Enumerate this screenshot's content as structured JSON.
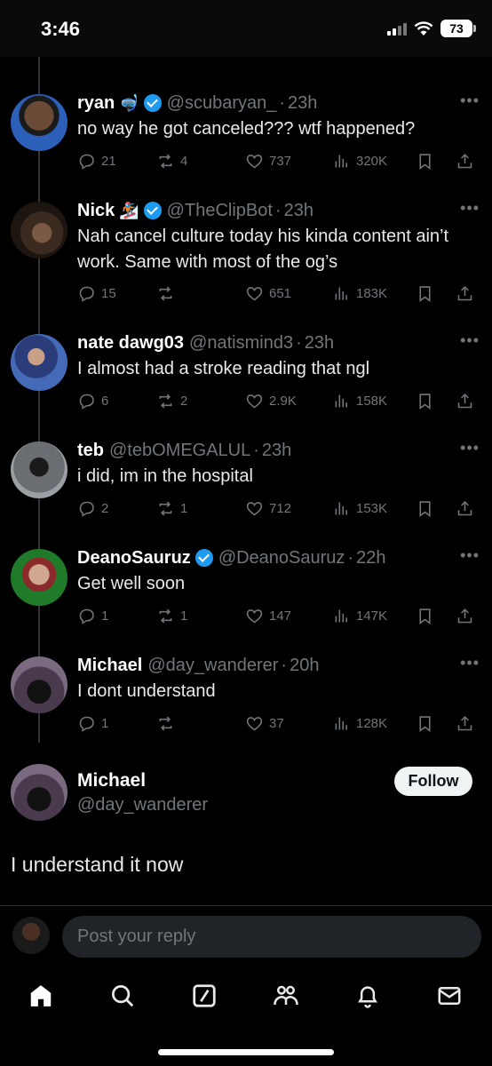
{
  "status": {
    "time": "3:46",
    "battery": "73"
  },
  "tweets": [
    {
      "name": "ryan",
      "emoji": "🤿",
      "verified": true,
      "handle": "@scubaryan_",
      "time": "23h",
      "text": "no way he got canceled??? wtf happened?",
      "replies": "21",
      "reposts": "4",
      "likes": "737",
      "views": "320K"
    },
    {
      "name": "Nick",
      "emoji": "🏂",
      "verified": true,
      "handle": "@TheClipBot",
      "time": "23h",
      "text": "Nah cancel culture today his kinda content ain’t work. Same with most of the og’s",
      "replies": "15",
      "reposts": "",
      "likes": "651",
      "views": "183K"
    },
    {
      "name": "nate dawg03",
      "emoji": "",
      "verified": false,
      "handle": "@natismind3",
      "time": "23h",
      "text": "I almost had a stroke reading that ngl",
      "replies": "6",
      "reposts": "2",
      "likes": "2.9K",
      "views": "158K"
    },
    {
      "name": "teb",
      "emoji": "",
      "verified": false,
      "handle": "@tebOMEGALUL",
      "time": "23h",
      "text": "i did, im in the hospital",
      "replies": "2",
      "reposts": "1",
      "likes": "712",
      "views": "153K"
    },
    {
      "name": "DeanoSauruz",
      "emoji": "",
      "verified": true,
      "handle": "@DeanoSauruz",
      "time": "22h",
      "text": "Get well soon",
      "replies": "1",
      "reposts": "1",
      "likes": "147",
      "views": "147K"
    },
    {
      "name": "Michael",
      "emoji": "",
      "verified": false,
      "handle": "@day_wanderer",
      "time": "20h",
      "text": "I dont understand",
      "replies": "1",
      "reposts": "",
      "likes": "37",
      "views": "128K"
    }
  ],
  "main_post": {
    "name": "Michael",
    "handle": "@day_wanderer",
    "follow_label": "Follow",
    "text": "I understand it now"
  },
  "reply": {
    "placeholder": "Post your reply"
  },
  "tabs": [
    "home-icon",
    "search-icon",
    "grok-icon",
    "communities-icon",
    "notifications-icon",
    "messages-icon"
  ],
  "colors": {
    "background": "#000000",
    "verified": "#1d9bf0",
    "muted": "#71767b",
    "text": "#e7e9ea"
  }
}
